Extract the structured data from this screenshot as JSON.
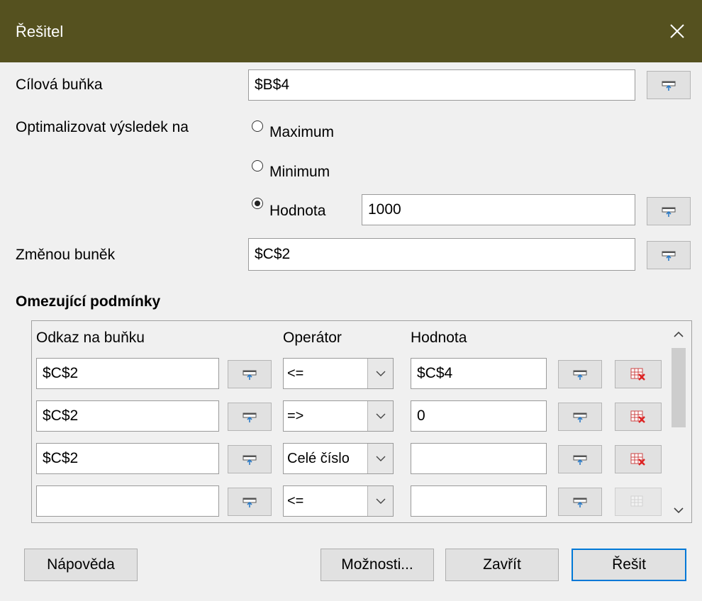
{
  "window": {
    "title": "Řešitel"
  },
  "target": {
    "label": "Cílová buňka",
    "value": "$B$4"
  },
  "optimize": {
    "label": "Optimalizovat výsledek na",
    "options": [
      {
        "label": "Maximum",
        "selected": false
      },
      {
        "label": "Minimum",
        "selected": false
      },
      {
        "label": "Hodnota",
        "selected": true
      }
    ],
    "value": "1000"
  },
  "changing": {
    "label": "Změnou buněk",
    "value": "$C$2"
  },
  "constraints": {
    "heading": "Omezující podmínky",
    "col_cell": "Odkaz na buňku",
    "col_operator": "Operátor",
    "col_value": "Hodnota",
    "rows": [
      {
        "cell": "$C$2",
        "operator": "<=",
        "value": "$C$4",
        "delete_enabled": true
      },
      {
        "cell": "$C$2",
        "operator": "=>",
        "value": "0",
        "delete_enabled": true
      },
      {
        "cell": "$C$2",
        "operator": "Celé číslo",
        "value": "",
        "delete_enabled": true
      },
      {
        "cell": "",
        "operator": "<=",
        "value": "",
        "delete_enabled": false
      }
    ]
  },
  "buttons": {
    "help": "Nápověda",
    "options": "Možnosti...",
    "close": "Zavřít",
    "solve": "Řešit"
  },
  "colors": {
    "titlebar": "#55511f",
    "focus": "#0078d7"
  },
  "icons": {
    "shrink": "shrink-icon",
    "delete": "delete-row-icon",
    "close": "close-icon"
  }
}
